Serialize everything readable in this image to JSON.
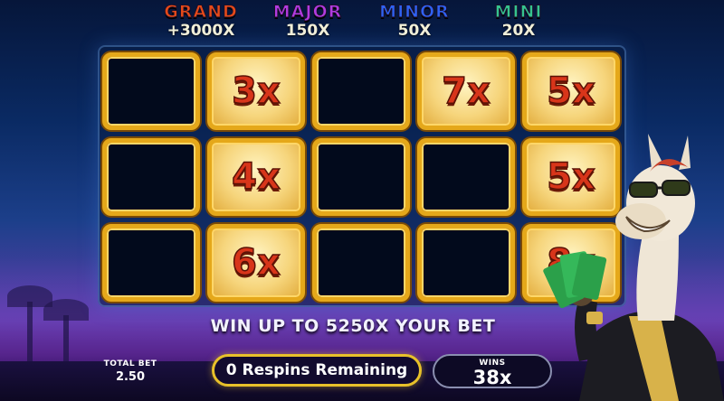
{
  "jackpots": [
    {
      "name": "GRAND",
      "value": "+3000X",
      "color": "#e64a19"
    },
    {
      "name": "MAJOR",
      "value": "150X",
      "color": "#b23be0"
    },
    {
      "name": "MINOR",
      "value": "50X",
      "color": "#2f62f2"
    },
    {
      "name": "MINI",
      "value": "20X",
      "color": "#35c48f"
    }
  ],
  "grid": {
    "rows": [
      [
        "",
        "3x",
        "",
        "7x",
        "5x"
      ],
      [
        "",
        "4x",
        "",
        "",
        "5x"
      ],
      [
        "",
        "6x",
        "",
        "",
        "8x"
      ]
    ]
  },
  "banner": "WIN UP TO 5250X YOUR BET",
  "footer": {
    "total_bet_label": "TOTAL BET",
    "total_bet_value": "2.50",
    "respins_label": "0 Respins Remaining",
    "wins_label": "WINS",
    "wins_value": "38x"
  },
  "colors": {
    "frame_gold": "#e5a81a",
    "multiplier_red": "#d8351a",
    "respins_border": "#e8c12a"
  },
  "icons": {
    "mascot": "llama-mascot"
  }
}
